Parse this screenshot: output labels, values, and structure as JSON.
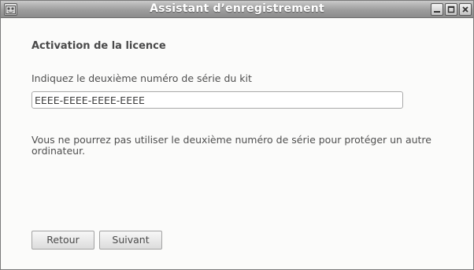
{
  "window": {
    "title": "Assistant d’enregistrement",
    "icons": {
      "app": "app-icon",
      "minimize": "minimize-icon",
      "maximize": "maximize-icon",
      "close": "close-icon"
    }
  },
  "content": {
    "heading": "Activation de la licence",
    "prompt": "Indiquez le deuxième numéro de série du kit",
    "serial_value": "EEEE-EEEE-EEEE-EEEE",
    "note": "Vous ne pourrez pas utiliser le deuxième numéro de série pour protéger un autre ordinateur."
  },
  "buttons": {
    "back_label": "Retour",
    "next_label": "Suivant"
  }
}
